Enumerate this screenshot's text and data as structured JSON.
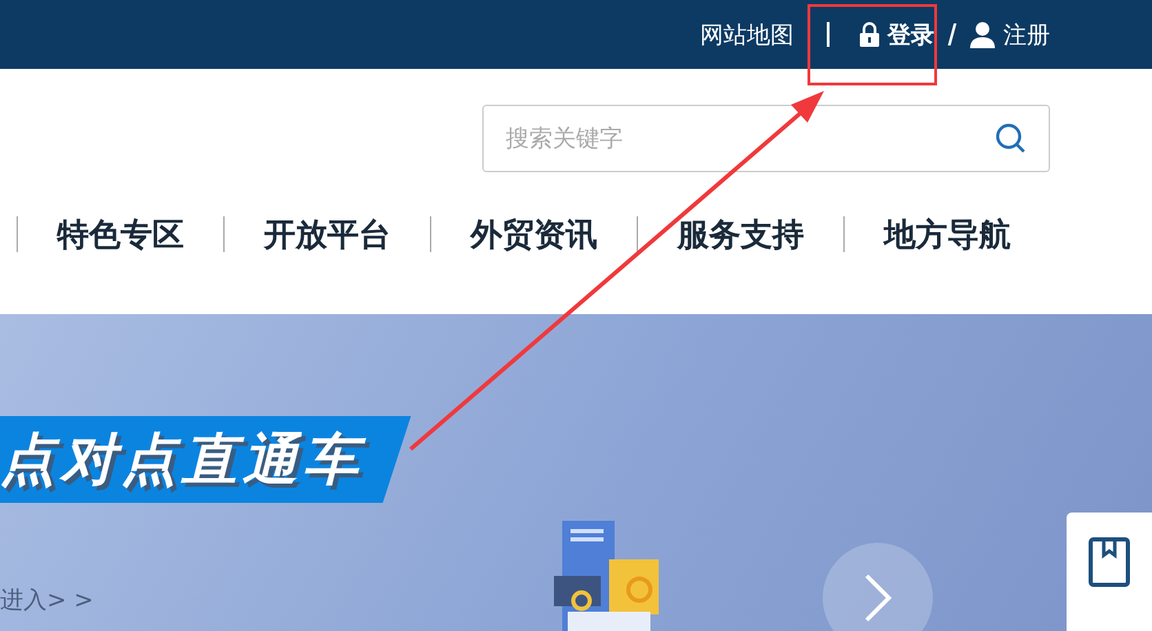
{
  "top_bar": {
    "links": [
      {
        "kind": "text",
        "label": "网站地图"
      },
      {
        "kind": "login",
        "label": "登录"
      },
      {
        "kind": "register",
        "label": "注册"
      }
    ]
  },
  "search": {
    "placeholder": "搜索关键字"
  },
  "nav": {
    "items": [
      {
        "label": "特色专区"
      },
      {
        "label": "开放平台"
      },
      {
        "label": "外贸资讯"
      },
      {
        "label": "服务支持"
      },
      {
        "label": "地方导航"
      }
    ]
  },
  "banner": {
    "title": "点对点直通车",
    "link": "进入> >"
  }
}
